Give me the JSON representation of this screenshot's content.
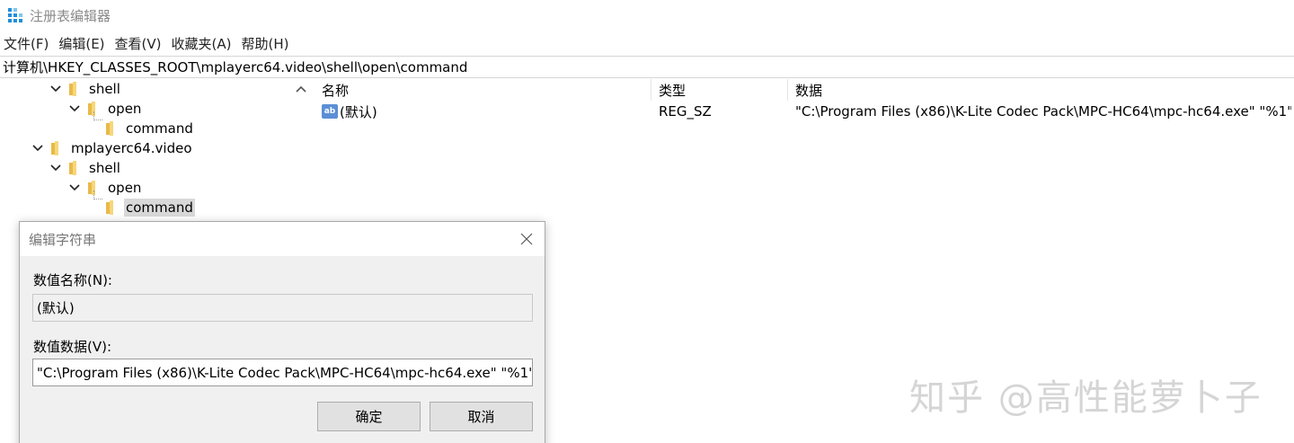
{
  "window": {
    "title": "注册表编辑器",
    "app_icon": "regedit-icon"
  },
  "menu": [
    "文件(F)",
    "编辑(E)",
    "查看(V)",
    "收藏夹(A)",
    "帮助(H)"
  ],
  "address": "计算机\\HKEY_CLASSES_ROOT\\mplayerc64.video\\shell\\open\\command",
  "tree": {
    "items": [
      {
        "label": "shell",
        "expanded": true
      },
      {
        "label": "open",
        "expanded": true
      },
      {
        "label": "command",
        "expanded": false
      },
      {
        "label": "mplayerc64.video",
        "expanded": true
      },
      {
        "label": "shell",
        "expanded": true
      },
      {
        "label": "open",
        "expanded": true
      },
      {
        "label": "command",
        "expanded": false,
        "selected": true
      }
    ]
  },
  "list": {
    "headers": {
      "name": "名称",
      "type": "类型",
      "data": "数据"
    },
    "rows": [
      {
        "name": "(默认)",
        "type": "REG_SZ",
        "data": "\"C:\\Program Files (x86)\\K-Lite Codec Pack\\MPC-HC64\\mpc-hc64.exe\" \"%1\"",
        "icon": "string-value-icon"
      }
    ]
  },
  "dialog": {
    "title": "编辑字符串",
    "name_label": "数值名称(N):",
    "name_value": "(默认)",
    "data_label": "数值数据(V):",
    "data_value": "\"C:\\Program Files (x86)\\K-Lite Codec Pack\\MPC-HC64\\mpc-hc64.exe\" \"%1\"",
    "ok_label": "确定",
    "cancel_label": "取消"
  },
  "watermark": "知乎 @高性能萝卜子",
  "colors": {
    "selection": "#d9d9d9",
    "folder": "#e9b949",
    "button_face": "#e1e1e1",
    "dialog_bg": "#f0f0f0"
  }
}
